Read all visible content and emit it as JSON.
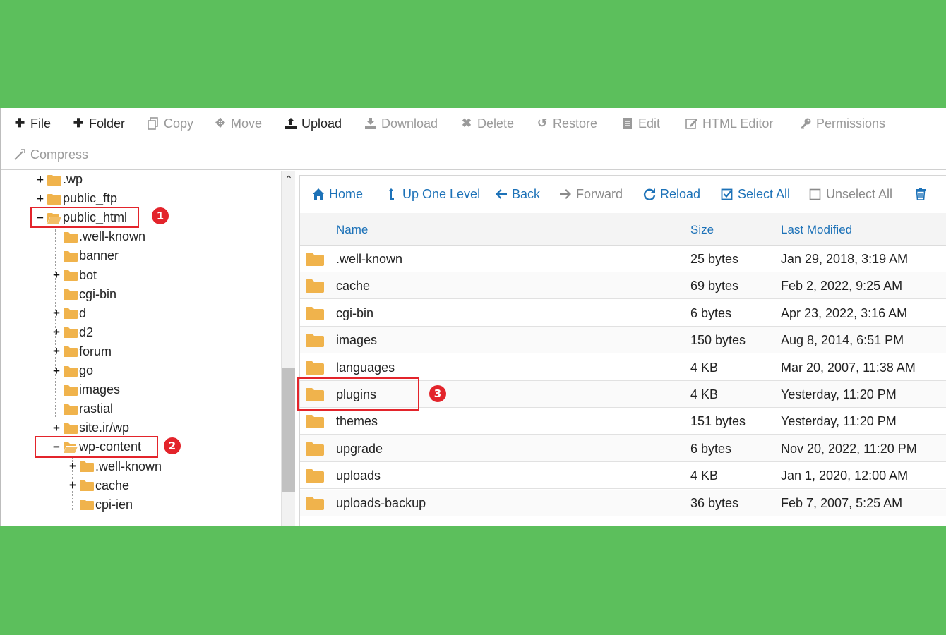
{
  "toolbar": {
    "file": "File",
    "folder": "Folder",
    "copy": "Copy",
    "move": "Move",
    "upload": "Upload",
    "download": "Download",
    "delete": "Delete",
    "restore": "Restore",
    "edit": "Edit",
    "html_editor": "HTML Editor",
    "permissions": "Permissions",
    "compress": "Compress"
  },
  "tree": {
    "items": [
      {
        "label": ".wp",
        "toggle": "+"
      },
      {
        "label": "public_ftp",
        "toggle": "+"
      },
      {
        "label": "public_html",
        "toggle": "−"
      },
      {
        "label": ".well-known",
        "toggle": ""
      },
      {
        "label": "banner",
        "toggle": ""
      },
      {
        "label": "bot",
        "toggle": "+"
      },
      {
        "label": "cgi-bin",
        "toggle": ""
      },
      {
        "label": "d",
        "toggle": "+"
      },
      {
        "label": "d2",
        "toggle": "+"
      },
      {
        "label": "forum",
        "toggle": "+"
      },
      {
        "label": "go",
        "toggle": "+"
      },
      {
        "label": "images",
        "toggle": ""
      },
      {
        "label": "rastial",
        "toggle": ""
      },
      {
        "label": "site.ir/wp",
        "toggle": "+"
      },
      {
        "label": "wp-content",
        "toggle": "−"
      },
      {
        "label": ".well-known",
        "toggle": "+"
      },
      {
        "label": "cache",
        "toggle": "+"
      },
      {
        "label": "cpi-ien",
        "toggle": ""
      }
    ]
  },
  "nav": {
    "home": "Home",
    "up_one_level": "Up One Level",
    "back": "Back",
    "forward": "Forward",
    "reload": "Reload",
    "select_all": "Select All",
    "unselect_all": "Unselect All"
  },
  "table": {
    "headers": {
      "name": "Name",
      "size": "Size",
      "modified": "Last Modified"
    },
    "rows": [
      {
        "name": ".well-known",
        "size": "25 bytes",
        "modified": "Jan 29, 2018, 3:19 AM"
      },
      {
        "name": "cache",
        "size": "69 bytes",
        "modified": "Feb 2, 2022, 9:25 AM"
      },
      {
        "name": "cgi-bin",
        "size": "6 bytes",
        "modified": "Apr 23, 2022, 3:16 AM"
      },
      {
        "name": "images",
        "size": "150 bytes",
        "modified": "Aug 8, 2014, 6:51 PM"
      },
      {
        "name": "languages",
        "size": "4 KB",
        "modified": "Mar 20, 2007, 11:38 AM"
      },
      {
        "name": "plugins",
        "size": "4 KB",
        "modified": "Yesterday, 11:20 PM"
      },
      {
        "name": "themes",
        "size": "151 bytes",
        "modified": "Yesterday, 11:20 PM"
      },
      {
        "name": "upgrade",
        "size": "6 bytes",
        "modified": "Nov 20, 2022, 11:20 PM"
      },
      {
        "name": "uploads",
        "size": "4 KB",
        "modified": "Jan 1, 2020, 12:00 AM"
      },
      {
        "name": "uploads-backup",
        "size": "36 bytes",
        "modified": "Feb 7, 2007, 5:25 AM"
      }
    ]
  },
  "callouts": {
    "one": "1",
    "two": "2",
    "three": "3"
  },
  "colors": {
    "background": "#5cbf5c",
    "link": "#1d72b8",
    "folder": "#f0b34c",
    "callout": "#e3242b"
  }
}
